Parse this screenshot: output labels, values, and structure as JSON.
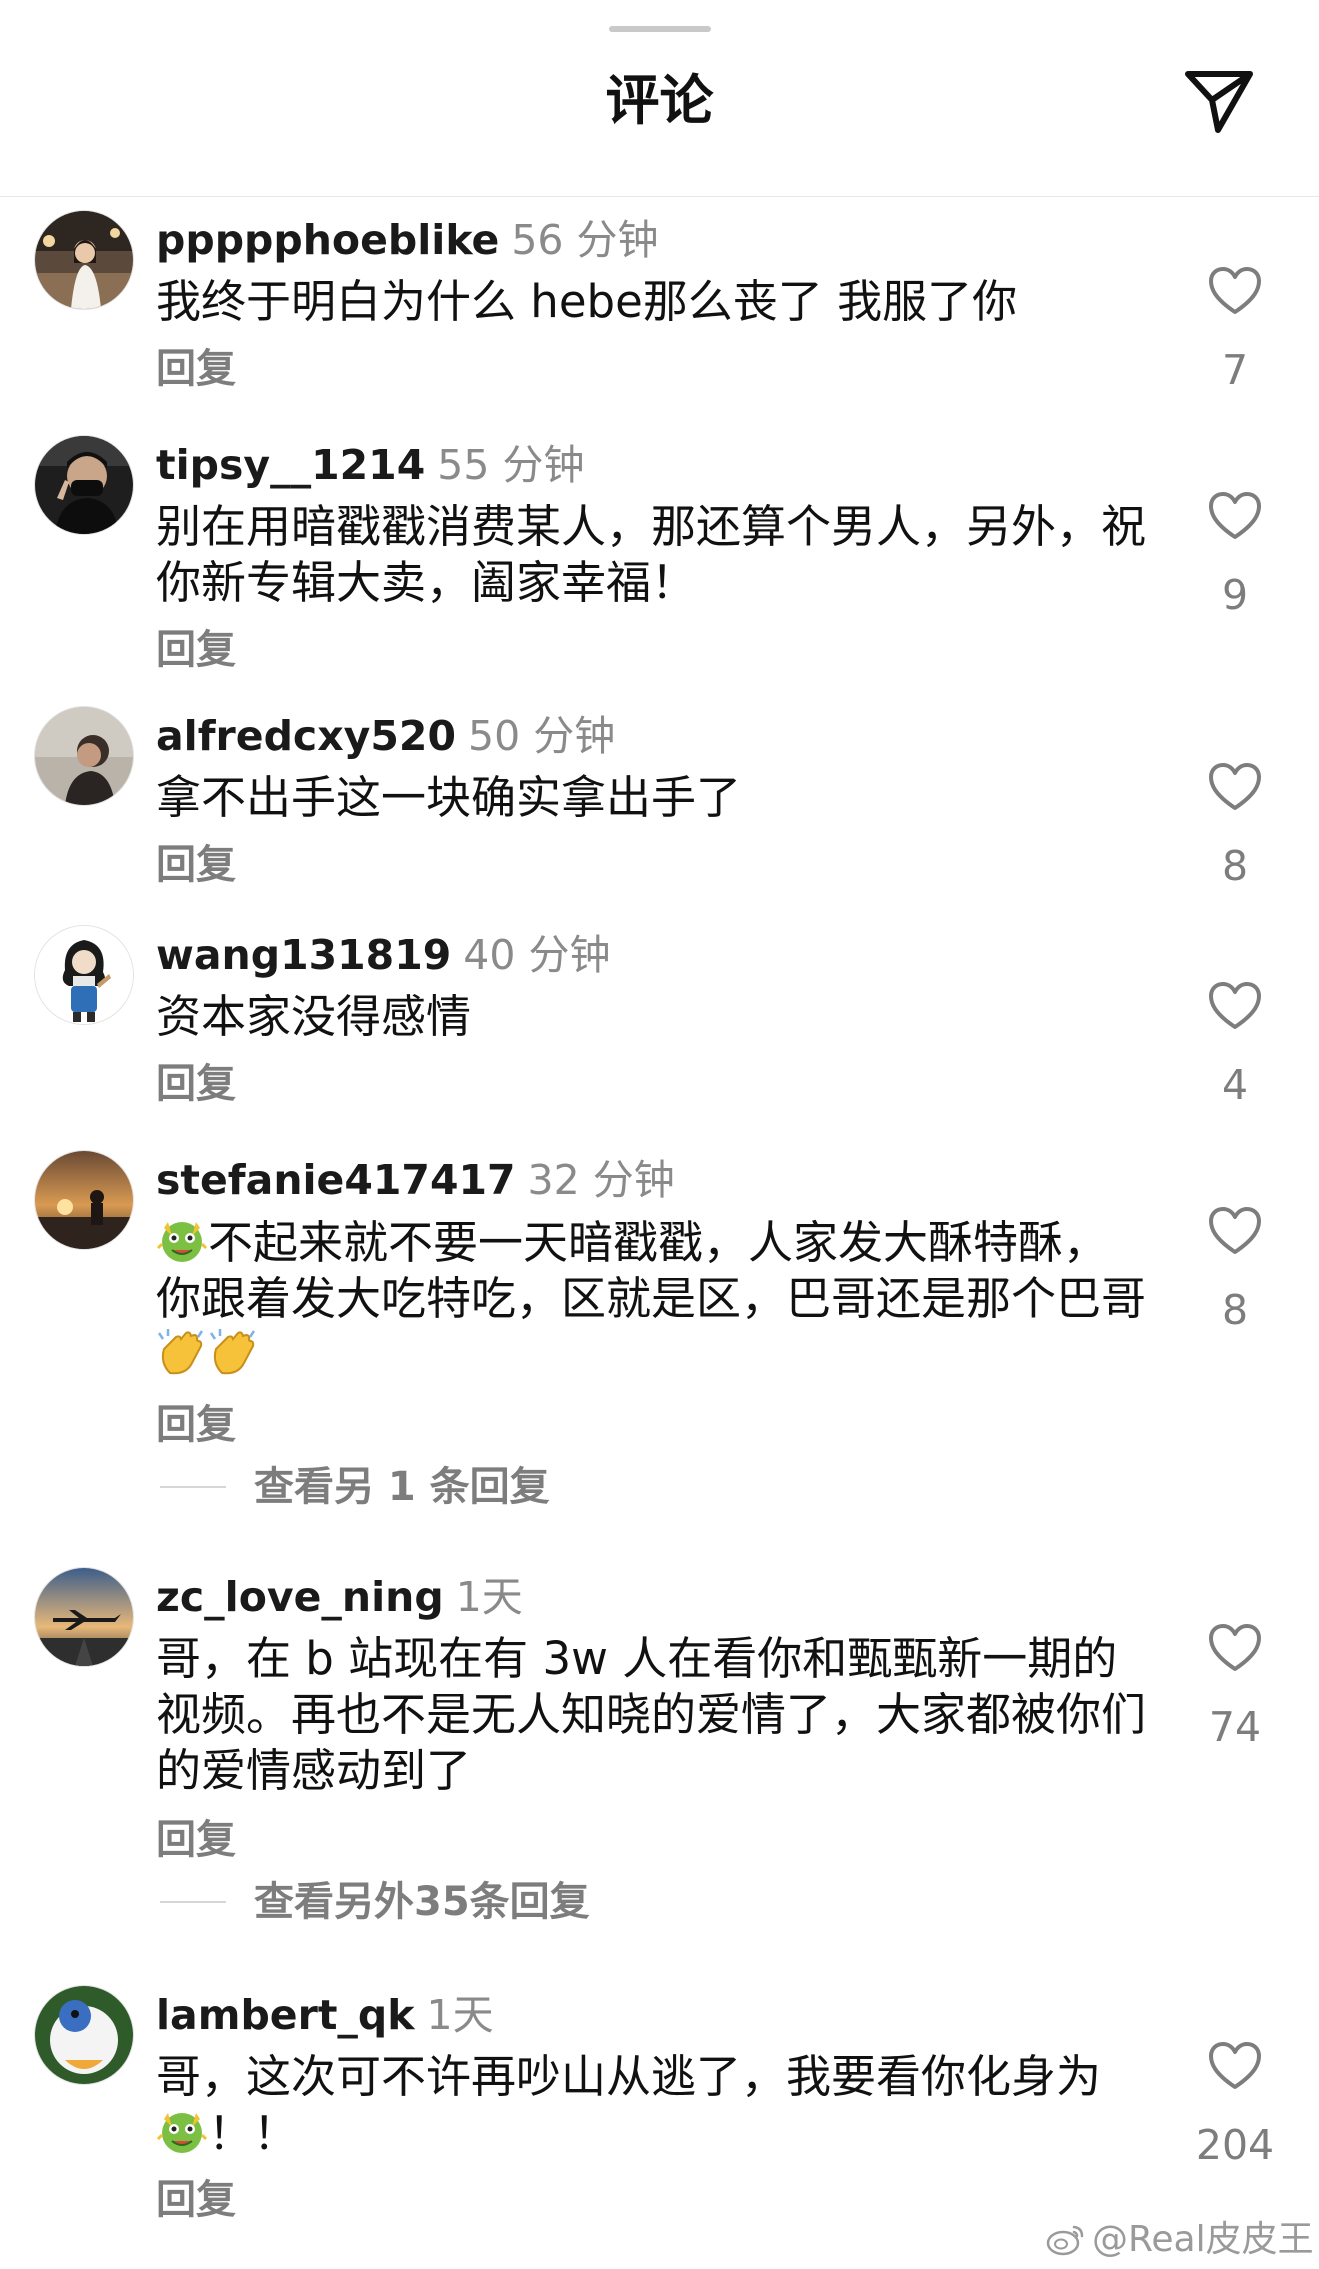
{
  "header": {
    "title": "评论",
    "share_icon": "send-icon"
  },
  "comments": [
    {
      "username": "ppppphoeblike",
      "time": "56 分钟",
      "text": "我终于明白为什么 hebe那么丧了 我服了你",
      "reply_label": "回复",
      "likes": "7"
    },
    {
      "username": "tipsy__1214",
      "time": "55 分钟",
      "text": "别在用暗戳戳消费某人，那还算个男人，另外，祝你新专辑大卖，阖家幸福！",
      "reply_label": "回复",
      "likes": "9"
    },
    {
      "username": "alfredcxy520",
      "time": "50 分钟",
      "text": "拿不出手这一块确实拿出手了",
      "reply_label": "回复",
      "likes": "8"
    },
    {
      "username": "wang131819",
      "time": "40 分钟",
      "text": "资本家没得感情",
      "reply_label": "回复",
      "likes": "4"
    },
    {
      "username": "stefanie417417",
      "time": "32 分钟",
      "text_part1": "不起来就不要一天暗戳戳，人家发大酥特酥，你跟着发大吃特吃，区就是区，巴哥还是那个巴哥",
      "reply_label": "回复",
      "likes": "8",
      "view_replies": "查看另 1 条回复"
    },
    {
      "username": "zc_love_ning",
      "time": "1天",
      "text": "哥，在 b 站现在有 3w 人在看你和甄甄新一期的视频。再也不是无人知晓的爱情了，大家都被你们的爱情感动到了",
      "reply_label": "回复",
      "likes": "74",
      "view_replies": "查看另外35条回复"
    },
    {
      "username": "lambert_qk",
      "time": "1天",
      "text_part1": "哥，这次可不许再吵山从逃了，我要看你化身为",
      "text_part2": "！！",
      "reply_label": "回复",
      "likes": "204"
    }
  ],
  "watermark": "@Real皮皮王"
}
